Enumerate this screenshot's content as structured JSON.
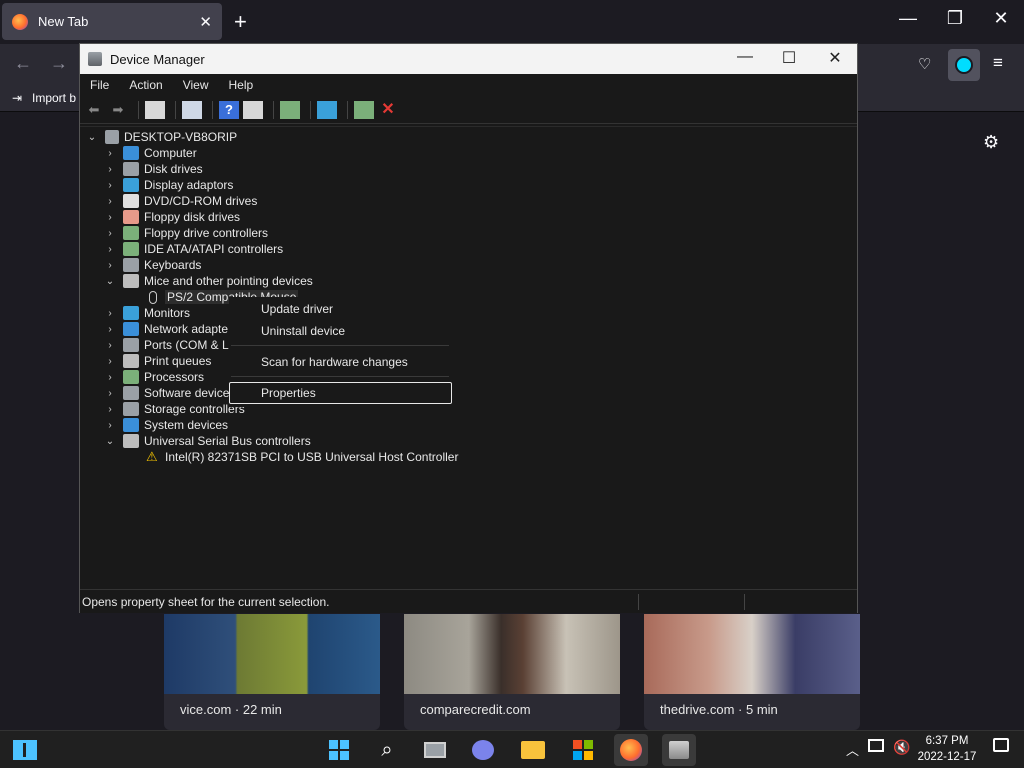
{
  "browser": {
    "tab_title": "New Tab",
    "tab_close": "✕",
    "new_tab": "+",
    "minimize": "—",
    "restore": "❐",
    "close": "✕",
    "bookmark_import": "Import b",
    "settings_icon": "gear-icon"
  },
  "tiles": [
    {
      "caption": "vice.com · 22 min",
      "color": "#2a3c55"
    },
    {
      "caption": "comparecredit.com",
      "color": "#6b6458"
    },
    {
      "caption": "thedrive.com · 5 min",
      "color": "#4a4f66"
    }
  ],
  "device_manager": {
    "title": "Device Manager",
    "menu": [
      "File",
      "Action",
      "View",
      "Help"
    ],
    "root": "DESKTOP-VB8ORIP",
    "nodes": [
      {
        "label": "Computer",
        "expanded": false,
        "icon": "#3a8fd9"
      },
      {
        "label": "Disk drives",
        "expanded": false,
        "icon": "#9aa0a6"
      },
      {
        "label": "Display adaptors",
        "expanded": false,
        "icon": "#3aa0d9"
      },
      {
        "label": "DVD/CD-ROM drives",
        "expanded": false,
        "icon": "#e0e0e0"
      },
      {
        "label": "Floppy disk drives",
        "expanded": false,
        "icon": "#e79a8a"
      },
      {
        "label": "Floppy drive controllers",
        "expanded": false,
        "icon": "#7bb07a"
      },
      {
        "label": "IDE ATA/ATAPI controllers",
        "expanded": false,
        "icon": "#7bb07a"
      },
      {
        "label": "Keyboards",
        "expanded": false,
        "icon": "#9aa0a6"
      },
      {
        "label": "Mice and other pointing devices",
        "expanded": true,
        "icon": "#bdbdbd",
        "children": [
          "PS/2 Compatible Mouse"
        ]
      },
      {
        "label": "Monitors",
        "expanded": false,
        "icon": "#3aa0d9"
      },
      {
        "label": "Network adapte",
        "expanded": false,
        "icon": "#3a8fd9"
      },
      {
        "label": "Ports (COM & L",
        "expanded": false,
        "icon": "#9aa0a6"
      },
      {
        "label": "Print queues",
        "expanded": false,
        "icon": "#bdbdbd"
      },
      {
        "label": "Processors",
        "expanded": false,
        "icon": "#7bb07a"
      },
      {
        "label": "Software device",
        "expanded": false,
        "icon": "#9aa0a6"
      },
      {
        "label": "Storage controllers",
        "expanded": false,
        "icon": "#9aa0a6"
      },
      {
        "label": "System devices",
        "expanded": false,
        "icon": "#3a8fd9"
      },
      {
        "label": "Universal Serial Bus controllers",
        "expanded": true,
        "icon": "#bdbdbd",
        "children": [
          "Intel(R) 82371SB PCI to USB Universal Host Controller"
        ]
      }
    ],
    "context_menu": {
      "update": "Update driver",
      "uninstall": "Uninstall device",
      "scan": "Scan for hardware changes",
      "properties": "Properties"
    },
    "status": "Opens property sheet for the current selection."
  },
  "taskbar": {
    "time": "6:37 PM",
    "date": "2022-12-17"
  }
}
